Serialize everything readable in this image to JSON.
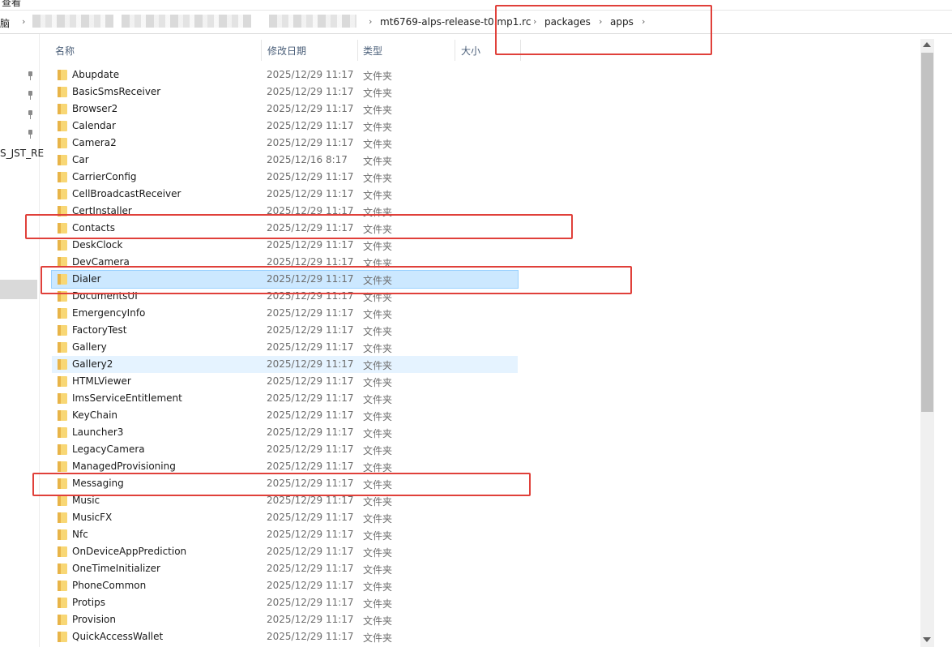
{
  "window": {
    "top_cut_label": "查看",
    "pc_label": "脑"
  },
  "breadcrumb": {
    "items": [
      "mt6769-alps-release-t0.mp1.rc",
      "packages",
      "apps"
    ],
    "separator": "›"
  },
  "nav": {
    "label": "S_JST_RE"
  },
  "columns": {
    "name": "名称",
    "date": "修改日期",
    "type": "类型",
    "size": "大小"
  },
  "files": [
    {
      "name": "Abupdate",
      "date": "2025/12/29 11:17",
      "type": "文件夹"
    },
    {
      "name": "BasicSmsReceiver",
      "date": "2025/12/29 11:17",
      "type": "文件夹"
    },
    {
      "name": "Browser2",
      "date": "2025/12/29 11:17",
      "type": "文件夹"
    },
    {
      "name": "Calendar",
      "date": "2025/12/29 11:17",
      "type": "文件夹"
    },
    {
      "name": "Camera2",
      "date": "2025/12/29 11:17",
      "type": "文件夹"
    },
    {
      "name": "Car",
      "date": "2025/12/16 8:17",
      "type": "文件夹"
    },
    {
      "name": "CarrierConfig",
      "date": "2025/12/29 11:17",
      "type": "文件夹"
    },
    {
      "name": "CellBroadcastReceiver",
      "date": "2025/12/29 11:17",
      "type": "文件夹"
    },
    {
      "name": "CertInstaller",
      "date": "2025/12/29 11:17",
      "type": "文件夹"
    },
    {
      "name": "Contacts",
      "date": "2025/12/29 11:17",
      "type": "文件夹"
    },
    {
      "name": "DeskClock",
      "date": "2025/12/29 11:17",
      "type": "文件夹"
    },
    {
      "name": "DevCamera",
      "date": "2025/12/29 11:17",
      "type": "文件夹"
    },
    {
      "name": "Dialer",
      "date": "2025/12/29 11:17",
      "type": "文件夹"
    },
    {
      "name": "DocumentsUI",
      "date": "2025/12/29 11:17",
      "type": "文件夹"
    },
    {
      "name": "EmergencyInfo",
      "date": "2025/12/29 11:17",
      "type": "文件夹"
    },
    {
      "name": "FactoryTest",
      "date": "2025/12/29 11:17",
      "type": "文件夹"
    },
    {
      "name": "Gallery",
      "date": "2025/12/29 11:17",
      "type": "文件夹"
    },
    {
      "name": "Gallery2",
      "date": "2025/12/29 11:17",
      "type": "文件夹"
    },
    {
      "name": "HTMLViewer",
      "date": "2025/12/29 11:17",
      "type": "文件夹"
    },
    {
      "name": "ImsServiceEntitlement",
      "date": "2025/12/29 11:17",
      "type": "文件夹"
    },
    {
      "name": "KeyChain",
      "date": "2025/12/29 11:17",
      "type": "文件夹"
    },
    {
      "name": "Launcher3",
      "date": "2025/12/29 11:17",
      "type": "文件夹"
    },
    {
      "name": "LegacyCamera",
      "date": "2025/12/29 11:17",
      "type": "文件夹"
    },
    {
      "name": "ManagedProvisioning",
      "date": "2025/12/29 11:17",
      "type": "文件夹"
    },
    {
      "name": "Messaging",
      "date": "2025/12/29 11:17",
      "type": "文件夹"
    },
    {
      "name": "Music",
      "date": "2025/12/29 11:17",
      "type": "文件夹"
    },
    {
      "name": "MusicFX",
      "date": "2025/12/29 11:17",
      "type": "文件夹"
    },
    {
      "name": "Nfc",
      "date": "2025/12/29 11:17",
      "type": "文件夹"
    },
    {
      "name": "OnDeviceAppPrediction",
      "date": "2025/12/29 11:17",
      "type": "文件夹"
    },
    {
      "name": "OneTimeInitializer",
      "date": "2025/12/29 11:17",
      "type": "文件夹"
    },
    {
      "name": "PhoneCommon",
      "date": "2025/12/29 11:17",
      "type": "文件夹"
    },
    {
      "name": "Protips",
      "date": "2025/12/29 11:17",
      "type": "文件夹"
    },
    {
      "name": "Provision",
      "date": "2025/12/29 11:17",
      "type": "文件夹"
    },
    {
      "name": "QuickAccessWallet",
      "date": "2025/12/29 11:17",
      "type": "文件夹"
    }
  ],
  "selected_item": "Dialer",
  "hovered_item": "Gallery2",
  "highlighted_items": [
    "Contacts",
    "Dialer",
    "Messaging"
  ],
  "colors": {
    "annotation_red": "#e0403a",
    "selection_bg": "#cce8ff",
    "hover_bg": "#e5f3ff",
    "folder_yellow": "#f8d775"
  }
}
